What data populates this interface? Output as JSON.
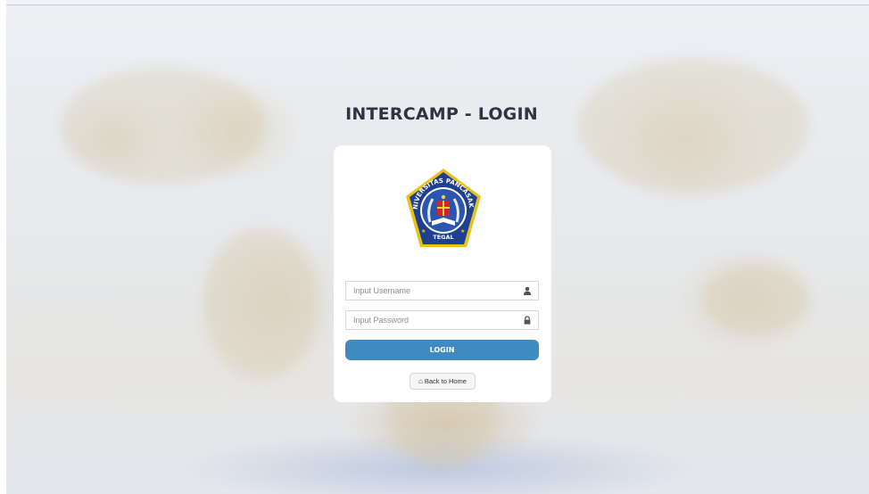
{
  "page": {
    "title": "INTERCAMP - LOGIN"
  },
  "logo": {
    "ring_text": "UNIVERSITAS PANCASAKTI",
    "city_text": "TEGAL"
  },
  "form": {
    "username_placeholder": "Input Username",
    "password_placeholder": "Input Password",
    "username_icon": "user-icon",
    "password_icon": "lock-icon",
    "login_label": "LOGIN",
    "home_label": "Back to Home",
    "home_icon": "home-icon"
  },
  "colors": {
    "login_button": "#3f8ac0",
    "title": "#2f3440",
    "logo_blue": "#1f3f8f",
    "logo_gold": "#e8c21b"
  }
}
